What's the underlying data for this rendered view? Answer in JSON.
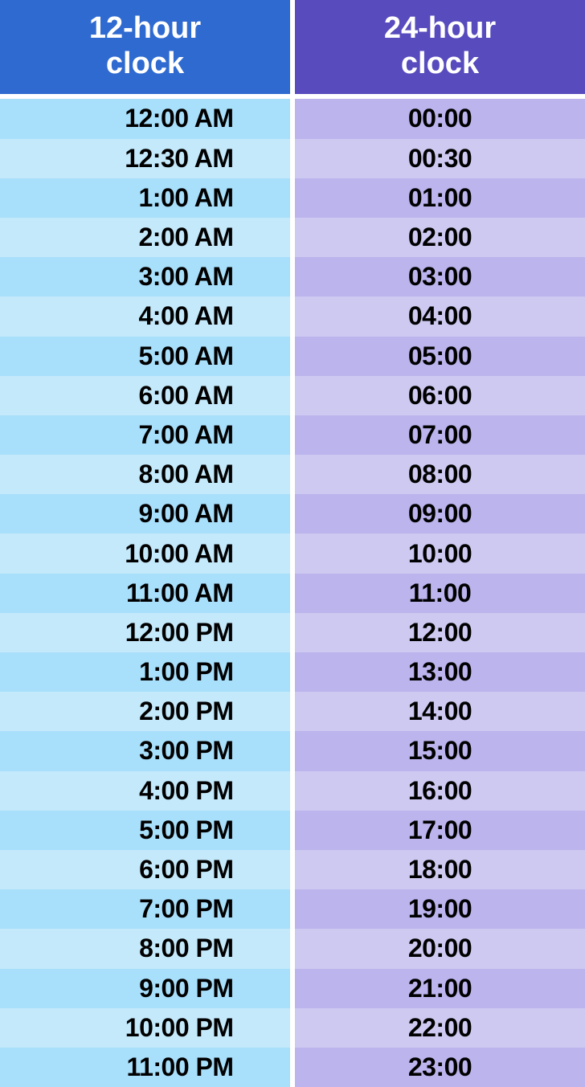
{
  "headers": {
    "h12_line1": "12-hour",
    "h12_line2": "clock",
    "h24_line1": "24-hour",
    "h24_line2": "clock"
  },
  "rows": [
    {
      "h12": "12:00 AM",
      "h24": "00:00"
    },
    {
      "h12": "12:30 AM",
      "h24": "00:30"
    },
    {
      "h12": "1:00 AM",
      "h24": "01:00"
    },
    {
      "h12": "2:00 AM",
      "h24": "02:00"
    },
    {
      "h12": "3:00 AM",
      "h24": "03:00"
    },
    {
      "h12": "4:00 AM",
      "h24": "04:00"
    },
    {
      "h12": "5:00 AM",
      "h24": "05:00"
    },
    {
      "h12": "6:00 AM",
      "h24": "06:00"
    },
    {
      "h12": "7:00 AM",
      "h24": "07:00"
    },
    {
      "h12": "8:00 AM",
      "h24": "08:00"
    },
    {
      "h12": "9:00 AM",
      "h24": "09:00"
    },
    {
      "h12": "10:00 AM",
      "h24": "10:00"
    },
    {
      "h12": "11:00 AM",
      "h24": "11:00"
    },
    {
      "h12": "12:00 PM",
      "h24": "12:00"
    },
    {
      "h12": "1:00 PM",
      "h24": "13:00"
    },
    {
      "h12": "2:00 PM",
      "h24": "14:00"
    },
    {
      "h12": "3:00 PM",
      "h24": "15:00"
    },
    {
      "h12": "4:00 PM",
      "h24": "16:00"
    },
    {
      "h12": "5:00 PM",
      "h24": "17:00"
    },
    {
      "h12": "6:00 PM",
      "h24": "18:00"
    },
    {
      "h12": "7:00 PM",
      "h24": "19:00"
    },
    {
      "h12": "8:00 PM",
      "h24": "20:00"
    },
    {
      "h12": "9:00 PM",
      "h24": "21:00"
    },
    {
      "h12": "10:00 PM",
      "h24": "22:00"
    },
    {
      "h12": "11:00 PM",
      "h24": "23:00"
    }
  ],
  "chart_data": {
    "type": "table",
    "title": "12-hour clock vs 24-hour clock",
    "columns": [
      "12-hour clock",
      "24-hour clock"
    ],
    "rows": [
      [
        "12:00 AM",
        "00:00"
      ],
      [
        "12:30 AM",
        "00:30"
      ],
      [
        "1:00 AM",
        "01:00"
      ],
      [
        "2:00 AM",
        "02:00"
      ],
      [
        "3:00 AM",
        "03:00"
      ],
      [
        "4:00 AM",
        "04:00"
      ],
      [
        "5:00 AM",
        "05:00"
      ],
      [
        "6:00 AM",
        "06:00"
      ],
      [
        "7:00 AM",
        "07:00"
      ],
      [
        "8:00 AM",
        "08:00"
      ],
      [
        "9:00 AM",
        "09:00"
      ],
      [
        "10:00 AM",
        "10:00"
      ],
      [
        "11:00 AM",
        "11:00"
      ],
      [
        "12:00 PM",
        "12:00"
      ],
      [
        "1:00 PM",
        "13:00"
      ],
      [
        "2:00 PM",
        "14:00"
      ],
      [
        "3:00 PM",
        "15:00"
      ],
      [
        "4:00 PM",
        "16:00"
      ],
      [
        "5:00 PM",
        "17:00"
      ],
      [
        "6:00 PM",
        "18:00"
      ],
      [
        "7:00 PM",
        "19:00"
      ],
      [
        "8:00 PM",
        "20:00"
      ],
      [
        "9:00 PM",
        "21:00"
      ],
      [
        "10:00 PM",
        "22:00"
      ],
      [
        "11:00 PM",
        "23:00"
      ]
    ]
  }
}
